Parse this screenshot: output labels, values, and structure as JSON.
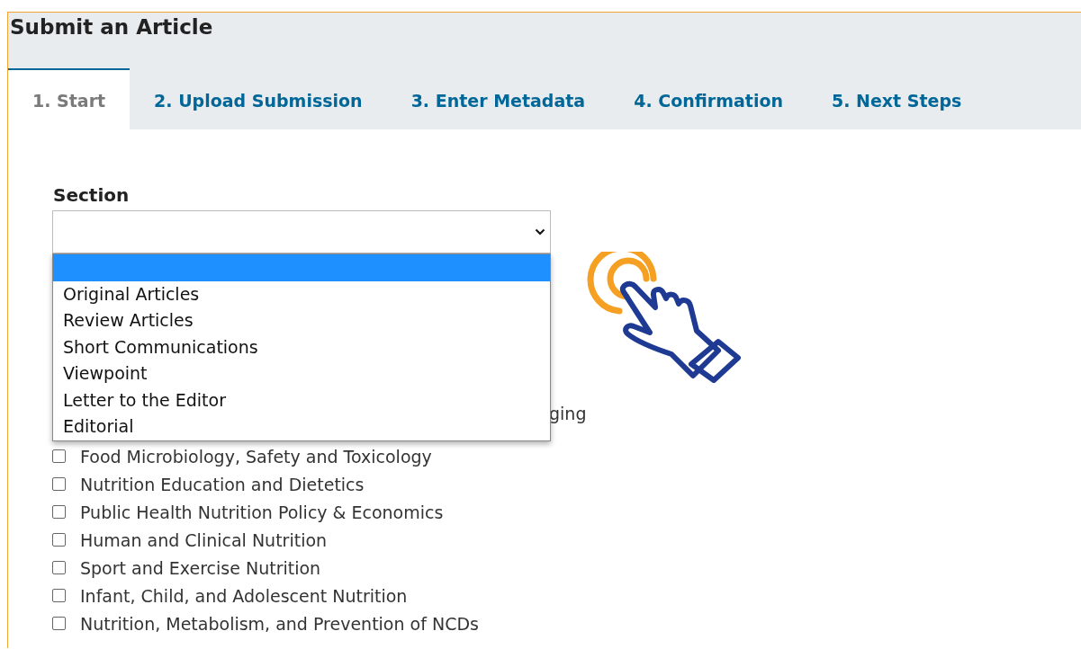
{
  "page": {
    "title": "Submit an Article"
  },
  "tabs": [
    {
      "label": "1. Start",
      "selected": true
    },
    {
      "label": "2. Upload Submission",
      "selected": false
    },
    {
      "label": "3. Enter Metadata",
      "selected": false
    },
    {
      "label": "4. Confirmation",
      "selected": false
    },
    {
      "label": "5. Next Steps",
      "selected": false
    }
  ],
  "section": {
    "label": "Section",
    "expanded": true,
    "options": [
      {
        "selected": true
      },
      {
        "label": "Original Articles",
        "selected": false
      },
      {
        "label": "Review Articles",
        "selected": false
      },
      {
        "label": "Short Communications",
        "selected": false
      },
      {
        "label": "Viewpoint",
        "selected": false
      },
      {
        "label": "Letter to the Editor",
        "selected": false
      },
      {
        "label": "Editorial",
        "selected": false
      }
    ]
  },
  "categories": [
    {
      "kind": "fragment",
      "label": "ging"
    },
    {
      "kind": "checkbox",
      "label": "Food Microbiology, Safety and Toxicology",
      "checked": false
    },
    {
      "kind": "checkbox",
      "label": "Nutrition Education and Dietetics",
      "checked": false
    },
    {
      "kind": "checkbox",
      "label": "Public Health Nutrition Policy & Economics",
      "checked": false
    },
    {
      "kind": "checkbox",
      "label": "Human and Clinical Nutrition",
      "checked": false
    },
    {
      "kind": "checkbox",
      "label": "Sport and Exercise Nutrition",
      "checked": false
    },
    {
      "kind": "checkbox",
      "label": "Infant, Child, and Adolescent Nutrition",
      "checked": false
    },
    {
      "kind": "checkbox",
      "label": "Nutrition, Metabolism, and Prevention of NCDs",
      "checked": false
    }
  ]
}
